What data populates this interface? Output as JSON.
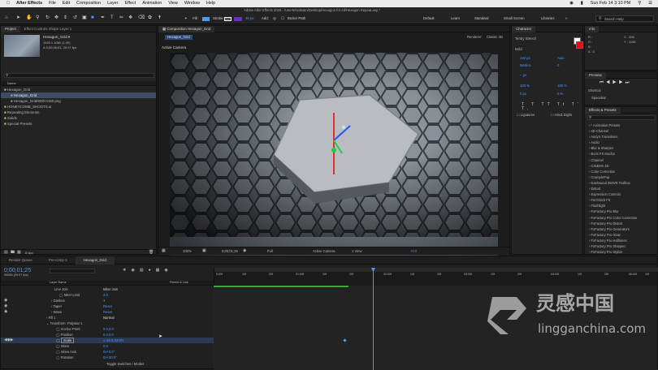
{
  "menubar": {
    "app": "After Effects",
    "items": [
      "File",
      "Edit",
      "Composition",
      "Layer",
      "Effect",
      "Animation",
      "View",
      "Window",
      "Help"
    ],
    "clock": "Sun Feb 14  3:10 PM"
  },
  "toolbar": {
    "fill": "Fill:",
    "stroke": "Stroke:",
    "stroke_px": "40 px",
    "add": "Add:",
    "bezier": "Bezier Path",
    "path": "Adobe After Effects 2020 - /Users/nicksam/Desktop/Hexagon for All/Hexagon Repeat.aep *",
    "workspaces": [
      "Default",
      "Learn",
      "Standard",
      "Small Screen",
      "Libraries"
    ],
    "search": "Search Help"
  },
  "project": {
    "tabs": [
      "Project",
      "Effect Controls Shape Layer 1"
    ],
    "thumb_title": "Hexagon_Grid ▾",
    "thumb_info1": "1920 x 1080 (1.00)",
    "thumb_info2": "Δ 0;00;06;01, 29.97 fps",
    "col_name": "Name",
    "items": [
      "Hexagon_Grid",
      "Hexagon_Grid",
      "Hexagon_Grid0000-0150.png",
      "HONEYCOMB_SHOOTS.ai",
      "Repeating Elements",
      "Solids",
      "Special Presets"
    ],
    "bpc": "8 bpc"
  },
  "comp": {
    "tab": "Composition Hexagon_Grid",
    "sub_tab": "Hexagon_Grid",
    "active_camera": "Active Camera",
    "renderer": "Renderer:",
    "renderer_value": "Classic 3D",
    "zoom": "100%",
    "timecode": "0;00;01;25",
    "quality": "Full",
    "camera": "Active Camera",
    "views": "1 View",
    "offset": "+0.0"
  },
  "character": {
    "title": "Character",
    "font": "Tenby Stencil",
    "style": "Bold",
    "size": "140 px",
    "leading": "Auto",
    "kerning": "Metrics",
    "tracking": "0",
    "stroke": "-- px",
    "vscale": "100 %",
    "hscale": "100 %",
    "baseline": "0 px",
    "tsume": "0 %",
    "ligatures": "Ligatures",
    "hindi": "Hindi Digits"
  },
  "info": {
    "title": "Info",
    "r": "R :",
    "g": "G :",
    "b": "B :",
    "a": "A : 0",
    "x": "X : 398",
    "y": "Y : 1190"
  },
  "preview": {
    "title": "Preview",
    "shortcut": "Shortcut",
    "shortcut_value": "Spacebar"
  },
  "effects": {
    "title": "Effects & Presets",
    "search_ph": "",
    "items": [
      "* Animation Presets",
      "3D Channel",
      "Andy's Transitions",
      "Audio",
      "Blur & Sharpen",
      "Boris FX Mocha",
      "Channel",
      "CINEMA 4D",
      "Color Correction",
      "CrumplePop",
      "Dashwood 360VR Toolbox",
      "Distort",
      "Expression Controls",
      "FerrShick FX",
      "Flashlight",
      "FxFactory Pro Blur",
      "FxFactory Pro Color Correction",
      "FxFactory Pro Distort",
      "FxFactory Pro Generators",
      "FxFactory Pro Glow",
      "FxFactory Pro Halftones",
      "FxFactory Pro Sharpen",
      "FxFactory Pro Stylize"
    ]
  },
  "timeline": {
    "tabs": [
      "Render Queue",
      "Pre-comp 3",
      "Hexagon_Grid"
    ],
    "timecode": "0;00;01;25",
    "frames": "00055 (29.97 fps)",
    "col_layer": "Layer Name",
    "col_parent": "Parent & Link",
    "rows": [
      {
        "label": "Line Join",
        "value": "Miter Join"
      },
      {
        "label": "Miter Limit",
        "value": "4.0"
      },
      {
        "label": "Dashes",
        "value": "+"
      },
      {
        "label": "Taper",
        "value": "Reset"
      },
      {
        "label": "Wave",
        "value": "Reset"
      },
      {
        "label": "Fill 1",
        "value": "Normal"
      },
      {
        "label": "Transform: Polystar 1",
        "value": ""
      },
      {
        "label": "Anchor Point",
        "value": "0.0,0.0"
      },
      {
        "label": "Position",
        "value": "0.0,0.0"
      },
      {
        "label": "Scale",
        "value": "∞ 63.0,63.0%"
      },
      {
        "label": "Skew",
        "value": "0.0"
      },
      {
        "label": "Skew Axis",
        "value": "0x+0.0°"
      },
      {
        "label": "Rotation",
        "value": "0x+30.0°"
      }
    ],
    "ruler": [
      "0:00f",
      "10f",
      "20f",
      "01:00f",
      "10f",
      "20f",
      "02:00f",
      "10f",
      "20f",
      "03:00f",
      "10f",
      "20f",
      "04:00f",
      "10f",
      "20f",
      "05:00f",
      "10f",
      "20f"
    ],
    "toggle": "Toggle Switches / Modes"
  },
  "watermark": {
    "cn": "灵感中国",
    "url": "lingganchina.com"
  },
  "colors": {
    "accent": "#4a9bff",
    "bg": "#1d1d1d",
    "panel": "#232323"
  }
}
